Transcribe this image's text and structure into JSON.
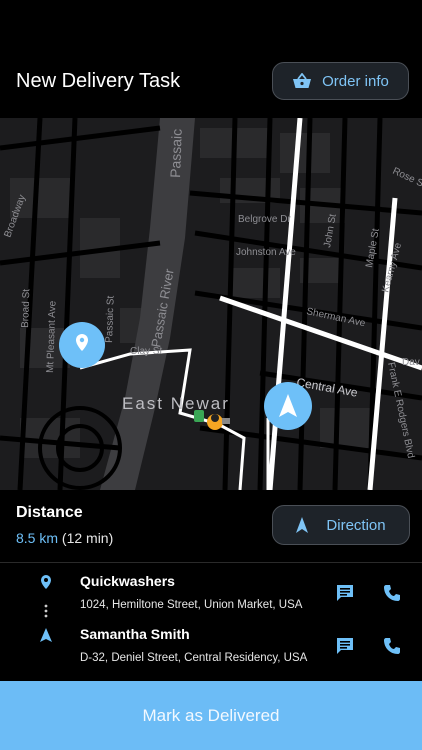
{
  "header": {
    "title": "New Delivery Task",
    "order_info_label": "Order info"
  },
  "map": {
    "labels": {
      "passaic_1": "Passaic",
      "passaic_river": "Passaic River",
      "rose_st": "Rose St",
      "broadway": "Broadway",
      "belgrove_dr": "Belgrove Dr",
      "john_st": "John St",
      "maple_st": "Maple St",
      "kearny_ave": "Kearny Ave",
      "johnston_ave": "Johnston Ave",
      "broad_st": "Broad St",
      "mt_pleasant_ave": "Mt Pleasant Ave",
      "passaic_st": "Passaic St",
      "clay_st": "Clay St",
      "sherman_ave": "Sherman Ave",
      "central_ave": "Central Ave",
      "east_newark": "East Newar",
      "frank_e_rodgers": "Frank E Rodgers Blvd",
      "dav": "Dav"
    }
  },
  "distance": {
    "label": "Distance",
    "value": "8.5 km",
    "duration": "(12 min)",
    "direction_label": "Direction"
  },
  "stops": [
    {
      "name": "Quickwashers",
      "address": "1024, Hemiltone Street, Union Market, USA"
    },
    {
      "name": "Samantha Smith",
      "address": "D-32,  Deniel Street, Central Residency, USA"
    }
  ],
  "cta": {
    "label": "Mark as Delivered"
  },
  "colors": {
    "accent": "#6cbcf6",
    "button_text": "#7fc4f5",
    "background": "#000000"
  }
}
